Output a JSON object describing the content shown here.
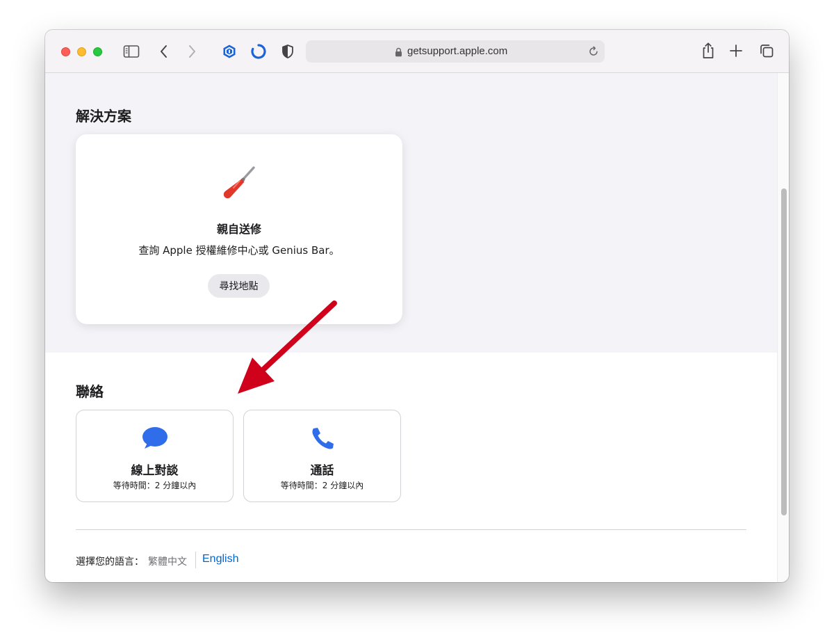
{
  "browser": {
    "url": "getsupport.apple.com"
  },
  "solutions": {
    "heading": "解決方案",
    "card": {
      "title": "親自送修",
      "description": "查詢 Apple 授權維修中心或 Genius Bar。",
      "button": "尋找地點"
    }
  },
  "contact": {
    "heading": "聯絡",
    "options": [
      {
        "title": "線上對談",
        "subtitle": "等待時間：2 分鐘以內"
      },
      {
        "title": "通話",
        "subtitle": "等待時間：2 分鐘以內"
      }
    ]
  },
  "language": {
    "label": "選擇您的語言：",
    "current": "繁體中文",
    "other": "English"
  },
  "colors": {
    "accent_blue": "#2f6dea",
    "link_blue": "#0066cc",
    "annotation_arrow": "#d0021b"
  }
}
